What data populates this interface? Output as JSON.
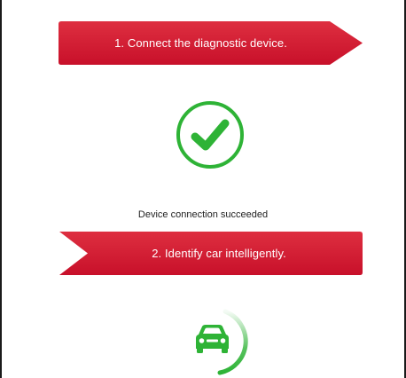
{
  "steps": {
    "step1_label": "1. Connect the diagnostic device.",
    "step2_label": "2. Identify car intelligently."
  },
  "status": {
    "connection_message": "Device connection succeeded"
  },
  "icons": {
    "success": "check-circle-icon",
    "vehicle": "car-icon"
  },
  "colors": {
    "banner_red": "#d0162c",
    "banner_red_light": "#e03a48",
    "success_green": "#2eb336"
  }
}
